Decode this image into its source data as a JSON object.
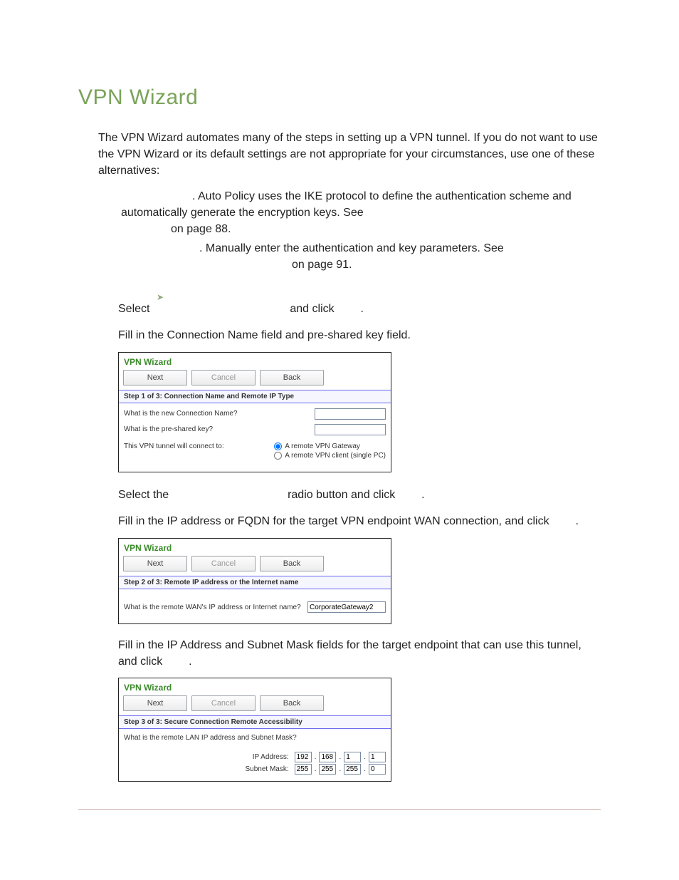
{
  "title": "VPN Wizard",
  "intro": "The VPN Wizard automates many of the steps in setting up a VPN tunnel. If you do not want to use the VPN Wizard or its default settings are not appropriate for your circumstances, use one of these alternatives:",
  "alt1_a": ". Auto Policy uses the IKE protocol to define the authentication scheme and",
  "alt1_b": "automatically generate the encryption keys. See",
  "alt1_c": "on page 88.",
  "alt2_a": ". Manually enter the authentication and key parameters. See",
  "alt2_b": "on page 91.",
  "step_select": "Select",
  "step_andclick": "and click",
  "period": ".",
  "step_fill1": "Fill in the Connection Name field and pre-shared key field.",
  "wizard_title": "VPN Wizard",
  "btn_next": "Next",
  "btn_cancel": "Cancel",
  "btn_back": "Back",
  "step1_header": "Step 1 of 3: Connection Name and Remote IP Type",
  "q_conn_name": "What is the new Connection Name?",
  "q_psk": "What is the pre-shared key?",
  "q_connect_to": "This VPN tunnel will connect to:",
  "radio_gateway": "A remote VPN Gateway",
  "radio_client": "A remote VPN client (single PC)",
  "step_select_the": "Select the",
  "step_radio_and_click": "radio button and click",
  "step_fill2": "Fill in the IP address or FQDN for the target VPN endpoint WAN connection, and click",
  "step2_header": "Step 2 of 3: Remote IP address or the Internet name",
  "q_remote_wan": "What is the remote WAN's IP address or Internet name?",
  "remote_wan_value": "CorporateGateway2",
  "step_fill3a": "Fill in the IP Address and Subnet Mask fields for the target endpoint that can use this tunnel,",
  "step_fill3b": "and click",
  "step3_header": "Step 3 of 3: Secure Connection Remote Accessibility",
  "q_remote_lan": "What is the remote LAN IP address and Subnet Mask?",
  "ip_label": "IP Address:",
  "mask_label": "Subnet Mask:",
  "ip": [
    "192",
    "168",
    "1",
    "1"
  ],
  "mask": [
    "255",
    "255",
    "255",
    "0"
  ]
}
